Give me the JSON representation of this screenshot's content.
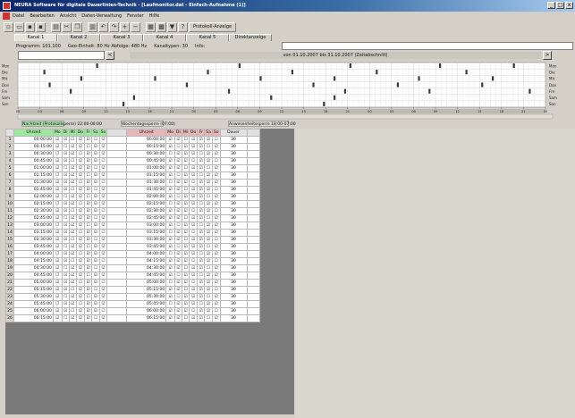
{
  "window": {
    "title": "NEURA Software für digitale Dauerlinien-Technik - [Laufmonitor.dat - Einfach-Aufnahme (1)]",
    "controls": [
      "_",
      "□",
      "x"
    ]
  },
  "menu": [
    "Datei",
    "Bearbeiten",
    "Ansicht",
    "Daten-Verwaltung",
    "Fenster",
    "Hilfe"
  ],
  "toolbar": {
    "icons": [
      "new-icon",
      "open-icon",
      "save-icon",
      "save-all-icon",
      "print-icon",
      "cut-icon",
      "copy-icon",
      "paste-icon",
      "undo-icon",
      "redo-icon",
      "zoom-in-icon",
      "zoom-out-icon",
      "chart-icon",
      "grid-icon",
      "filter-icon",
      "help-icon"
    ],
    "button_label": "Protokoll-Anzeige"
  },
  "tabs": [
    "Kanal 1",
    "Kanal 2",
    "Kanal 3",
    "Kanal 4",
    "Kanal 5",
    "Direktanzeige"
  ],
  "info": {
    "program": "Programm: 101.100",
    "config": "Geo-Einheit: 80 Hz  Abfolge: 480 Hz",
    "count": "Kanaltypen: 30",
    "label": "Info:"
  },
  "navigation": {
    "prev": "<",
    "next": ">",
    "range": "von 01.10.2007 bis 31.10.2007 (Zeitabschnitt)"
  },
  "timeline": {
    "row_labels": [
      "Mon",
      "Die",
      "Mit",
      "Don",
      "Fre",
      "Sam",
      "Son"
    ],
    "right_labels": [
      "Mon",
      "Die",
      "Mit",
      "Don",
      "Fre",
      "Sam",
      "Son"
    ],
    "axis_ticks": [
      "00",
      "03",
      "06",
      "09",
      "12",
      "15",
      "18",
      "21",
      "00",
      "03",
      "06",
      "09",
      "12",
      "15",
      "18",
      "21",
      "00",
      "03",
      "06",
      "09",
      "12",
      "15",
      "18",
      "21",
      "00"
    ]
  },
  "sections": {
    "left": "Nachtzeit (Protokollsperre) 22:00-06:00",
    "mid": "Wochentagssperre (07:00)",
    "right": "Anwesenheitssperre 18:00-07:00"
  },
  "table": {
    "head": [
      "",
      "Uhrzeit",
      "Mo",
      "Di",
      "Mi",
      "Do",
      "Fr",
      "Sa",
      "So",
      "",
      "Uhrzeit",
      "Mo",
      "Di",
      "Mi",
      "Do",
      "Fr",
      "Sa",
      "So",
      "Dauer",
      ""
    ],
    "rows": [
      {
        "n": "1",
        "a": "00:00:00",
        "b": "00:00:00",
        "c": "30"
      },
      {
        "n": "2",
        "a": "00:15:00",
        "b": "00:15:00",
        "c": "30"
      },
      {
        "n": "3",
        "a": "00:30:00",
        "b": "00:30:00",
        "c": "30"
      },
      {
        "n": "4",
        "a": "00:45:00",
        "b": "00:45:00",
        "c": "30"
      },
      {
        "n": "5",
        "a": "01:00:00",
        "b": "01:00:00",
        "c": "30"
      },
      {
        "n": "6",
        "a": "01:15:00",
        "b": "01:15:00",
        "c": "30"
      },
      {
        "n": "7",
        "a": "01:30:00",
        "b": "01:30:00",
        "c": "30"
      },
      {
        "n": "8",
        "a": "01:45:00",
        "b": "01:45:00",
        "c": "30"
      },
      {
        "n": "9",
        "a": "02:00:00",
        "b": "02:00:00",
        "c": "30"
      },
      {
        "n": "10",
        "a": "02:15:00",
        "b": "02:15:00",
        "c": "30"
      },
      {
        "n": "11",
        "a": "02:30:00",
        "b": "02:30:00",
        "c": "30"
      },
      {
        "n": "12",
        "a": "02:45:00",
        "b": "02:45:00",
        "c": "30"
      },
      {
        "n": "13",
        "a": "03:00:00",
        "b": "03:00:00",
        "c": "30"
      },
      {
        "n": "14",
        "a": "03:15:00",
        "b": "03:15:00",
        "c": "30"
      },
      {
        "n": "15",
        "a": "03:30:00",
        "b": "03:30:00",
        "c": "30"
      },
      {
        "n": "16",
        "a": "03:45:00",
        "b": "03:45:00",
        "c": "30"
      },
      {
        "n": "17",
        "a": "04:00:00",
        "b": "04:00:00",
        "c": "30"
      },
      {
        "n": "18",
        "a": "04:15:00",
        "b": "04:15:00",
        "c": "30"
      },
      {
        "n": "19",
        "a": "04:30:00",
        "b": "04:30:00",
        "c": "30"
      },
      {
        "n": "20",
        "a": "04:45:00",
        "b": "04:45:00",
        "c": "30"
      },
      {
        "n": "21",
        "a": "05:00:00",
        "b": "05:00:00",
        "c": "30"
      },
      {
        "n": "22",
        "a": "05:15:00",
        "b": "05:15:00",
        "c": "30"
      },
      {
        "n": "23",
        "a": "05:30:00",
        "b": "05:30:00",
        "c": "30"
      },
      {
        "n": "24",
        "a": "05:45:00",
        "b": "05:45:00",
        "c": "30"
      },
      {
        "n": "25",
        "a": "06:00:00",
        "b": "06:00:00",
        "c": "30"
      },
      {
        "n": "26",
        "a": "06:15:00",
        "b": "06:15:00",
        "c": "30"
      }
    ]
  },
  "colors": {
    "titlebar": "#0a246a",
    "green_header": "#9ee79e",
    "pink_header": "#e7b6b6",
    "empty_area": "#7a7a7a"
  }
}
